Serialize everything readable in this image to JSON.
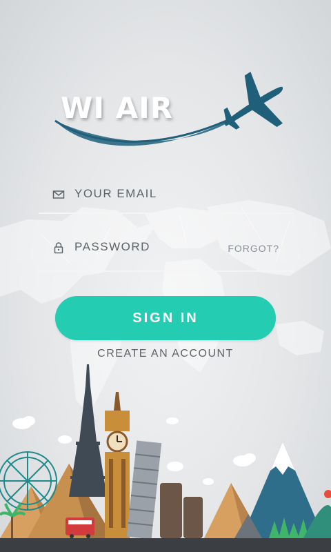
{
  "app": {
    "brand": "WI AIR"
  },
  "form": {
    "email_label": "YOUR EMAIL",
    "password_label": "PASSWORD",
    "forgot_label": "FORGOT?",
    "signin_label": "SIGN IN",
    "create_account_label": "CREATE AN ACCOUNT"
  },
  "icons": {
    "email": "envelope-icon",
    "password": "lock-icon",
    "logo": "airplane-icon"
  },
  "colors": {
    "accent": "#24cdb2",
    "brand_blue": "#1f5f7a",
    "text": "#5d6369",
    "muted": "#8a9096"
  }
}
